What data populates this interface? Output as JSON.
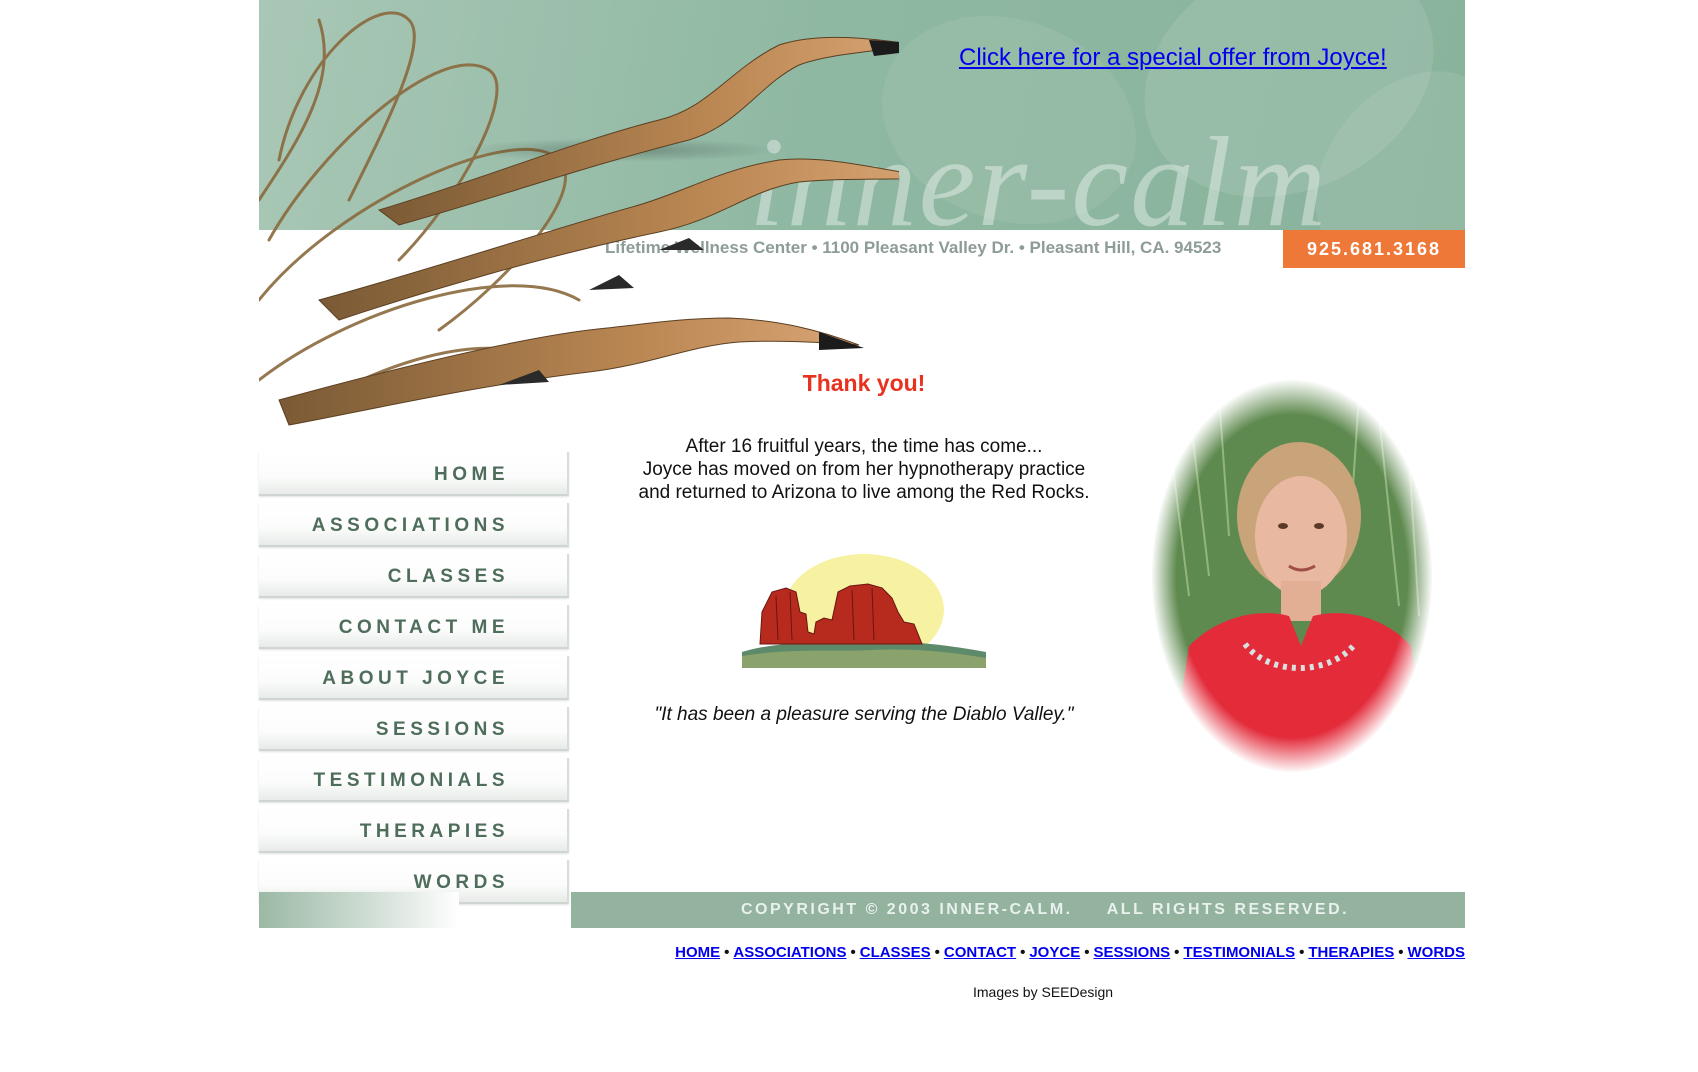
{
  "header": {
    "brand_wordmark": "inner-calm",
    "special_offer_link": "Click here for a special offer from Joyce!",
    "address": "Lifetime Wellness Center • 1100 Pleasant Valley Dr. • Pleasant Hill, CA. 94523",
    "phone": "925.681.3168"
  },
  "nav": {
    "items": [
      {
        "label": "HOME"
      },
      {
        "label": "ASSOCIATIONS"
      },
      {
        "label": "CLASSES"
      },
      {
        "label": "CONTACT ME"
      },
      {
        "label": "ABOUT JOYCE"
      },
      {
        "label": "SESSIONS"
      },
      {
        "label": "TESTIMONIALS"
      },
      {
        "label": "THERAPIES"
      },
      {
        "label": "WORDS"
      }
    ]
  },
  "main": {
    "heading": "Thank you!",
    "message_lines": [
      "After 16 fruitful years, the time has come...",
      "Joyce has moved on from her hypnotherapy practice",
      "and returned to Arizona to live among the Red Rocks."
    ],
    "quote": "\"It has been a pleasure serving the Diablo Valley.\""
  },
  "footer": {
    "copyright": "COPYRIGHT © 2003 INNER-CALM.     ALL RIGHTS RESERVED.",
    "links": [
      "HOME",
      "ASSOCIATIONS",
      "CLASSES",
      "CONTACT",
      "JOYCE",
      "SESSIONS",
      "TESTIMONIALS",
      "THERAPIES",
      "WORDS"
    ],
    "link_separator": "•",
    "credit": "Images by SEEDesign"
  },
  "colors": {
    "banner_green": "#8fb8a2",
    "phone_orange": "#ee7838",
    "heading_red": "#e8321f",
    "nav_text": "#4e6d5b",
    "link_blue": "#0000ee"
  },
  "icons": [
    "birds-artwork",
    "red-rocks-artwork",
    "portrait-photo"
  ]
}
